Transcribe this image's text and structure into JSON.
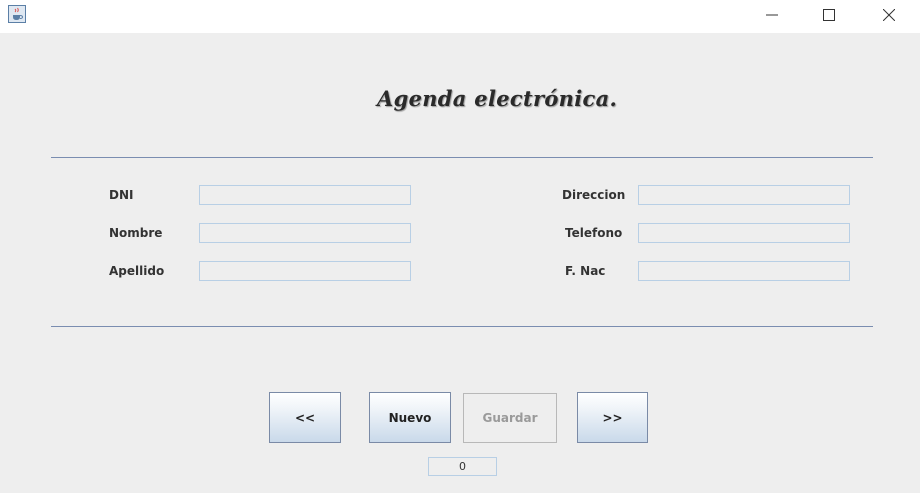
{
  "window": {
    "icon": "java-cup-icon",
    "controls": [
      "minimize-icon",
      "maximize-icon",
      "close-icon"
    ]
  },
  "heading": "Agenda electrónica.",
  "form": {
    "left": [
      {
        "label": "DNI",
        "value": ""
      },
      {
        "label": "Nombre",
        "value": ""
      },
      {
        "label": "Apellido",
        "value": ""
      }
    ],
    "right": [
      {
        "label": "Direccion",
        "value": ""
      },
      {
        "label": "Telefono",
        "value": ""
      },
      {
        "label": "F. Nac",
        "value": ""
      }
    ]
  },
  "buttons": {
    "prev": "<<",
    "new": "Nuevo",
    "save": "Guardar",
    "next": ">>"
  },
  "record_index": "0"
}
